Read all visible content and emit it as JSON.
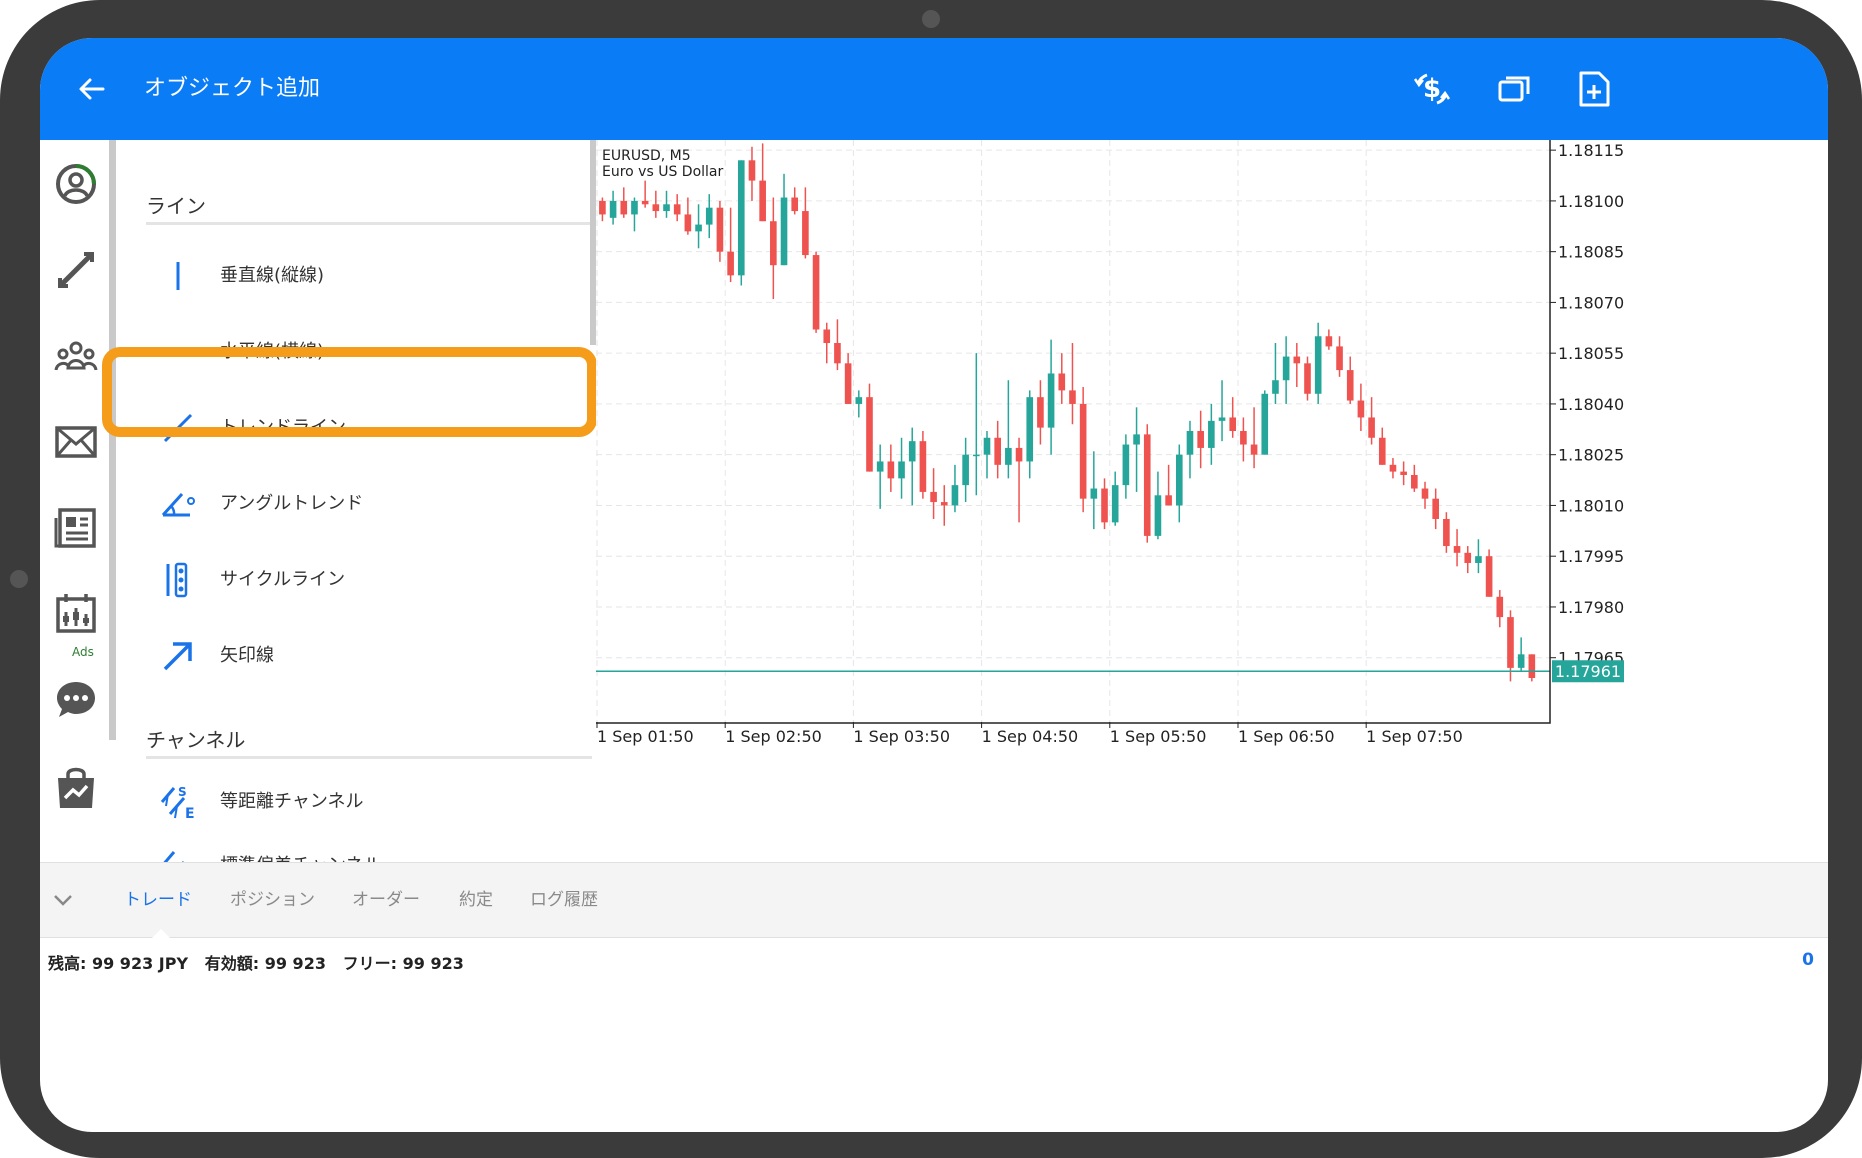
{
  "appbar": {
    "title": "オブジェクト追加",
    "back_icon": "arrow-left-icon",
    "actions": [
      "currency-exchange-icon",
      "window-icon",
      "add-document-icon"
    ],
    "color": "#0a7cf5"
  },
  "siderail": {
    "items": [
      "account-icon",
      "trade-arrows-icon",
      "community-icon",
      "mail-icon",
      "news-icon",
      "calendar-icon",
      "chat-icon",
      "market-icon"
    ],
    "calendar_badge": "Ads"
  },
  "objects_panel": {
    "section_lines": "ライン",
    "section_channels": "チャンネル",
    "items": [
      {
        "label": "垂直線(縦線)",
        "icon": "vertical-line-icon"
      },
      {
        "label": "水平線(横線)",
        "icon": "horizontal-line-icon"
      },
      {
        "label": "トレンドライン",
        "icon": "trend-line-icon",
        "highlighted": true
      },
      {
        "label": "アングルトレンド",
        "icon": "angle-trend-icon"
      },
      {
        "label": "サイクルライン",
        "icon": "cycle-line-icon"
      },
      {
        "label": "矢印線",
        "icon": "arrow-line-icon"
      },
      {
        "label": "等距離チャンネル",
        "icon": "equidistant-channel-icon"
      },
      {
        "label": "標準偏差チャンネル",
        "icon": "stddev-channel-icon"
      }
    ],
    "highlight_color": "#f59c1a",
    "accent": "#1a73e8"
  },
  "chart_data": {
    "type": "candlestick",
    "symbol": "EURUSD, M5",
    "description": "Euro vs US Dollar",
    "y_ticks": [
      "1.18115",
      "1.18100",
      "1.18085",
      "1.18070",
      "1.18055",
      "1.18040",
      "1.18025",
      "1.18010",
      "1.17995",
      "1.17980",
      "1.17965"
    ],
    "ylim": [
      1.17946,
      1.18118
    ],
    "x_ticks": [
      "1 Sep 01:50",
      "1 Sep 02:50",
      "1 Sep 03:50",
      "1 Sep 04:50",
      "1 Sep 05:50",
      "1 Sep 06:50",
      "1 Sep 07:50"
    ],
    "current_price": "1.17961",
    "current_price_value": 1.17961,
    "up_color": "#26a69a",
    "down_color": "#ef5350",
    "candles": [
      [
        1.181,
        1.18101,
        1.18094,
        1.18096
      ],
      [
        1.18095,
        1.18103,
        1.18093,
        1.181
      ],
      [
        1.181,
        1.18104,
        1.18095,
        1.18096
      ],
      [
        1.18096,
        1.18101,
        1.18091,
        1.181
      ],
      [
        1.181,
        1.18106,
        1.18098,
        1.18099
      ],
      [
        1.18099,
        1.18103,
        1.18095,
        1.18097
      ],
      [
        1.18097,
        1.18103,
        1.18095,
        1.18099
      ],
      [
        1.18099,
        1.18102,
        1.18094,
        1.18096
      ],
      [
        1.18096,
        1.18101,
        1.1809,
        1.18091
      ],
      [
        1.18091,
        1.18099,
        1.18086,
        1.18093
      ],
      [
        1.18093,
        1.18102,
        1.18089,
        1.18098
      ],
      [
        1.18098,
        1.181,
        1.18082,
        1.18085
      ],
      [
        1.18085,
        1.18098,
        1.18076,
        1.18078
      ],
      [
        1.18078,
        1.18112,
        1.18075,
        1.18112
      ],
      [
        1.18112,
        1.18116,
        1.181,
        1.18106
      ],
      [
        1.18106,
        1.18117,
        1.18094,
        1.18094
      ],
      [
        1.18094,
        1.18101,
        1.18071,
        1.18081
      ],
      [
        1.18081,
        1.18108,
        1.18081,
        1.18101
      ],
      [
        1.18101,
        1.18104,
        1.18096,
        1.18097
      ],
      [
        1.18097,
        1.18104,
        1.18083,
        1.18084
      ],
      [
        1.18084,
        1.18085,
        1.18061,
        1.18062
      ],
      [
        1.18062,
        1.18064,
        1.18052,
        1.18058
      ],
      [
        1.18058,
        1.18065,
        1.1805,
        1.18052
      ],
      [
        1.18052,
        1.18055,
        1.1804,
        1.1804
      ],
      [
        1.1804,
        1.18044,
        1.18036,
        1.18042
      ],
      [
        1.18042,
        1.18046,
        1.1802,
        1.1802
      ],
      [
        1.1802,
        1.18028,
        1.18009,
        1.18023
      ],
      [
        1.18023,
        1.18028,
        1.18014,
        1.18018
      ],
      [
        1.18018,
        1.1803,
        1.18012,
        1.18023
      ],
      [
        1.18023,
        1.18033,
        1.1801,
        1.18029
      ],
      [
        1.18029,
        1.18032,
        1.18012,
        1.18014
      ],
      [
        1.18014,
        1.18021,
        1.18006,
        1.18011
      ],
      [
        1.18011,
        1.18016,
        1.18004,
        1.1801
      ],
      [
        1.1801,
        1.18022,
        1.18008,
        1.18016
      ],
      [
        1.18016,
        1.1803,
        1.18011,
        1.18025
      ],
      [
        1.18025,
        1.18055,
        1.18013,
        1.18025
      ],
      [
        1.18025,
        1.18032,
        1.18018,
        1.1803
      ],
      [
        1.1803,
        1.18035,
        1.18018,
        1.18022
      ],
      [
        1.18022,
        1.18047,
        1.18018,
        1.18027
      ],
      [
        1.18027,
        1.1803,
        1.18005,
        1.18023
      ],
      [
        1.18023,
        1.18044,
        1.18018,
        1.18042
      ],
      [
        1.18042,
        1.18047,
        1.18028,
        1.18033
      ],
      [
        1.18033,
        1.18059,
        1.18025,
        1.18049
      ],
      [
        1.18049,
        1.18055,
        1.1804,
        1.18044
      ],
      [
        1.18044,
        1.18058,
        1.18034,
        1.1804
      ],
      [
        1.1804,
        1.18045,
        1.18008,
        1.18012
      ],
      [
        1.18012,
        1.18026,
        1.18003,
        1.18015
      ],
      [
        1.18015,
        1.18018,
        1.18003,
        1.18005
      ],
      [
        1.18005,
        1.1802,
        1.18004,
        1.18016
      ],
      [
        1.18016,
        1.18031,
        1.18012,
        1.18028
      ],
      [
        1.18028,
        1.18039,
        1.18014,
        1.18031
      ],
      [
        1.18031,
        1.18034,
        1.17999,
        1.18001
      ],
      [
        1.18001,
        1.1802,
        1.18,
        1.18013
      ],
      [
        1.18013,
        1.18022,
        1.1801,
        1.1801
      ],
      [
        1.1801,
        1.18028,
        1.18005,
        1.18025
      ],
      [
        1.18025,
        1.18035,
        1.18018,
        1.18032
      ],
      [
        1.18032,
        1.18038,
        1.18021,
        1.18027
      ],
      [
        1.18027,
        1.1804,
        1.18022,
        1.18035
      ],
      [
        1.18035,
        1.18047,
        1.18029,
        1.18036
      ],
      [
        1.18036,
        1.18042,
        1.1803,
        1.18032
      ],
      [
        1.18032,
        1.18036,
        1.18023,
        1.18028
      ],
      [
        1.18028,
        1.18039,
        1.18021,
        1.18025
      ],
      [
        1.18025,
        1.18044,
        1.18025,
        1.18043
      ],
      [
        1.18043,
        1.18058,
        1.1804,
        1.18047
      ],
      [
        1.18047,
        1.1806,
        1.1804,
        1.18054
      ],
      [
        1.18054,
        1.18058,
        1.18045,
        1.18052
      ],
      [
        1.18052,
        1.18054,
        1.18041,
        1.18043
      ],
      [
        1.18043,
        1.18064,
        1.1804,
        1.1806
      ],
      [
        1.1806,
        1.18062,
        1.18056,
        1.18057
      ],
      [
        1.18057,
        1.1806,
        1.18048,
        1.1805
      ],
      [
        1.1805,
        1.18054,
        1.1804,
        1.18041
      ],
      [
        1.18041,
        1.18046,
        1.18032,
        1.18036
      ],
      [
        1.18036,
        1.18042,
        1.18028,
        1.1803
      ],
      [
        1.1803,
        1.18033,
        1.18022,
        1.18022
      ],
      [
        1.18022,
        1.18024,
        1.18018,
        1.1802
      ],
      [
        1.1802,
        1.18023,
        1.18016,
        1.18019
      ],
      [
        1.18019,
        1.18022,
        1.18014,
        1.18015
      ],
      [
        1.18015,
        1.18017,
        1.18009,
        1.18012
      ],
      [
        1.18012,
        1.18015,
        1.18003,
        1.18006
      ],
      [
        1.18006,
        1.18008,
        1.17996,
        1.17998
      ],
      [
        1.17998,
        1.18003,
        1.17992,
        1.17996
      ],
      [
        1.17996,
        1.17998,
        1.1799,
        1.17993
      ],
      [
        1.17993,
        1.18,
        1.1799,
        1.17995
      ],
      [
        1.17995,
        1.17997,
        1.17983,
        1.17983
      ],
      [
        1.17983,
        1.17985,
        1.17974,
        1.17977
      ],
      [
        1.17977,
        1.17979,
        1.17958,
        1.17962
      ],
      [
        1.17962,
        1.17971,
        1.17961,
        1.17966
      ],
      [
        1.17966,
        1.17966,
        1.17958,
        1.17959
      ]
    ]
  },
  "bottom_tabs": {
    "collapse_icon": "chevron-down-icon",
    "items": [
      "トレード",
      "ポジション",
      "オーダー",
      "約定",
      "ログ履歴"
    ],
    "active_index": 0
  },
  "status_bar": {
    "summary": "残高: 99 923 JPY   有効額: 99 923   フリー: 99 923",
    "count": "0"
  }
}
